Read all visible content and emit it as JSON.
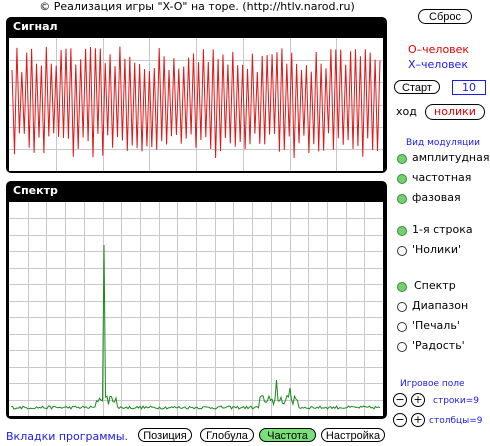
{
  "title": "© Реализация игры \"X-O\" на торе. (http://htlv.narod.ru)",
  "signal_panel": {
    "label": "Сигнал"
  },
  "spectrum_panel": {
    "label": "Спектр"
  },
  "reset_button": "Сброс",
  "players": {
    "o": "О–человек",
    "x": "Х–человек"
  },
  "start_button": "Старт",
  "counter_value": "10",
  "turn_label": "ход",
  "turn_value": "нолики",
  "modulation": {
    "title": "Вид модуляции",
    "options": [
      {
        "label": "амплитудная",
        "selected": true
      },
      {
        "label": "частотная",
        "selected": true
      },
      {
        "label": "фазовая",
        "selected": true
      }
    ]
  },
  "source": {
    "options": [
      {
        "label": "1-я строка",
        "selected": true
      },
      {
        "label": "'Нолики'",
        "selected": false
      }
    ]
  },
  "view": {
    "options": [
      {
        "label": "Спектр",
        "selected": true
      },
      {
        "label": "Диапазон",
        "selected": false
      },
      {
        "label": "'Печаль'",
        "selected": false
      },
      {
        "label": "'Радость'",
        "selected": false
      }
    ]
  },
  "field": {
    "title": "Игровое поле",
    "rows_label": "строки=9",
    "cols_label": "столбцы=9"
  },
  "bottom": {
    "label": "Вкладки программы.",
    "tabs": [
      {
        "label": "Позиция",
        "active": false
      },
      {
        "label": "Глобула",
        "active": false
      },
      {
        "label": "Частота",
        "active": true
      },
      {
        "label": "Настройка",
        "active": false
      }
    ]
  },
  "colors": {
    "signal": "#e01818",
    "spectrum": "#1a8a1a",
    "active_radio": "#6fd26f",
    "accent_blue": "#1a1aee",
    "accent_red": "#e00000"
  }
}
